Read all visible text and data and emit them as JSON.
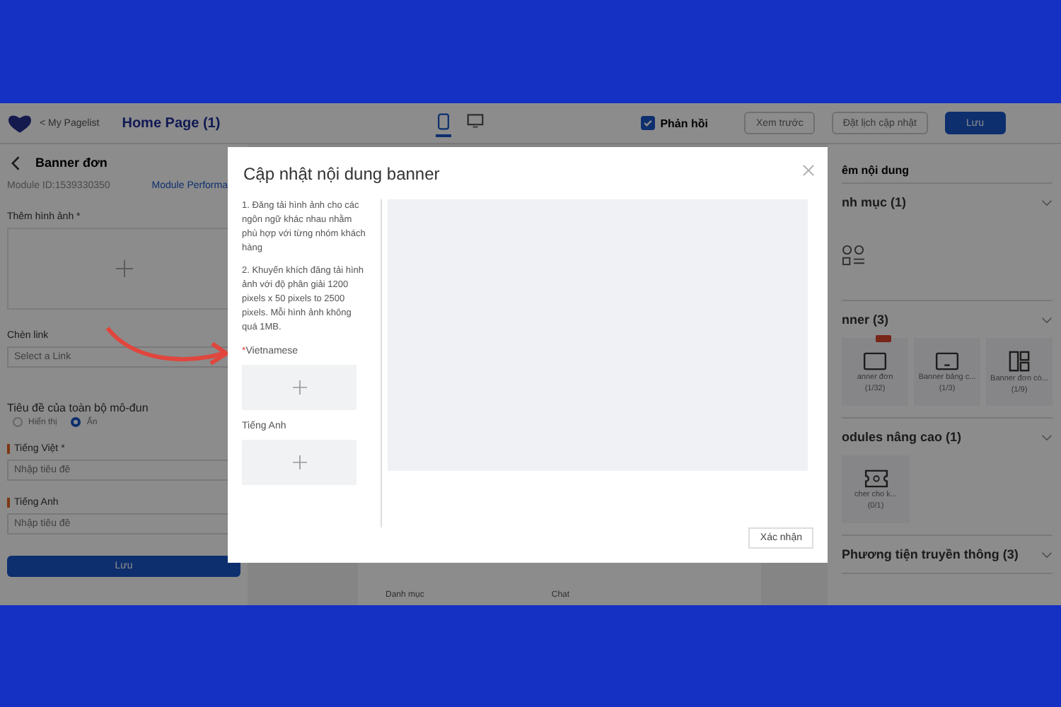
{
  "header": {
    "back_link": "< My Pagelist",
    "page_title": "Home Page (1)",
    "devices": [
      {
        "kind": "mobile",
        "selected": true
      },
      {
        "kind": "desktop",
        "selected": false
      }
    ],
    "feedback": {
      "label": "Phản hồi",
      "checked": true
    },
    "buttons": [
      {
        "label": "Xem trước",
        "kind": "outline"
      },
      {
        "label": "Đặt lịch cập nhật",
        "kind": "outline"
      },
      {
        "label": "Lưu",
        "kind": "primary"
      }
    ]
  },
  "left_panel": {
    "title": "Banner đơn",
    "module_id": "Module ID:1539330350",
    "performance_link": "Module Performa",
    "image_label": "Thêm hình ảnh *",
    "link_label": "Chèn link",
    "link_placeholder": "Select a Link",
    "module_title_label": "Tiêu đề của toàn bộ mô-đun",
    "radios": [
      {
        "label": "Hiển thị",
        "selected": false
      },
      {
        "label": "Ẩn",
        "selected": true
      }
    ],
    "fields": [
      {
        "label": "Tiếng Việt *",
        "placeholder": "Nhập tiêu đề"
      },
      {
        "label": "Tiếng Anh",
        "placeholder": "Nhập tiêu đề"
      }
    ],
    "save": "Lưu"
  },
  "preview": {
    "tabs": [
      "Danh mục",
      "Chat"
    ]
  },
  "right_panel": {
    "title": "êm nội dung",
    "sections": [
      {
        "title": "nh mục (1)",
        "items": [
          {
            "kind": "category",
            "hot": false
          }
        ]
      },
      {
        "title": "nner (3)",
        "items": [
          {
            "kind": "single",
            "name": "anner đơn",
            "count": "(1/32)",
            "hot": true
          },
          {
            "kind": "board",
            "name": "Banner bảng c...",
            "count": "(1/3)",
            "hot": false
          },
          {
            "kind": "grid",
            "name": "Banner đơn có...",
            "count": "(1/9)",
            "hot": false
          }
        ]
      },
      {
        "title": "odules nâng cao (1)",
        "items": [
          {
            "kind": "voucher",
            "name": "cher cho k...",
            "count": "(0/1)",
            "hot": false
          }
        ]
      },
      {
        "title": "Phương tiện truyền thông (3)"
      }
    ]
  },
  "dialog": {
    "title": "Cập nhật nội dung banner",
    "notes": [
      "1. Đăng tải hình ảnh cho các ngôn ngữ khác nhau nhằm phù hợp với từng nhóm khách hàng",
      "2. Khuyến khích đăng tải hình ảnh với độ phân giải 1200 pixels x 50 pixels to 2500 pixels. Mỗi hình ảnh không quá 1MB."
    ],
    "uploads": [
      {
        "mark": "*",
        "label": "Vietnamese"
      },
      {
        "label": "Tiếng Anh"
      }
    ],
    "confirm": "Xác nhận"
  }
}
